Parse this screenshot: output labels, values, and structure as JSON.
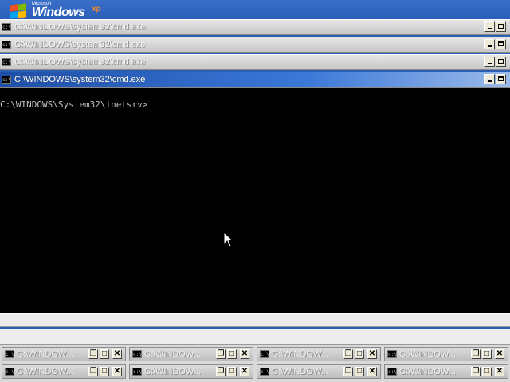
{
  "desktop": {
    "logo": {
      "microsoft": "Microsoft",
      "windows": "Windows",
      "xp": "xp"
    }
  },
  "title_bars": [
    {
      "title": "C:\\WINDOWS\\system32\\cmd.exe",
      "state": "inactive"
    },
    {
      "title": "C:\\WINDOWS\\system32\\cmd.exe",
      "state": "inactive"
    },
    {
      "title": "C:\\WINDOWS\\system32\\cmd.exe",
      "state": "inactive"
    },
    {
      "title": "C:\\WINDOWS\\system32\\cmd.exe",
      "state": "active"
    }
  ],
  "console": {
    "prompt": "C:\\WINDOWS\\System32\\inetsrv>",
    "background": "#000000",
    "text_color": "#c0c0c0"
  },
  "minimized_windows": {
    "row1": [
      {
        "label": "C:\\WINDOW..."
      },
      {
        "label": "C:\\WINDOW..."
      },
      {
        "label": "C:\\WINDOW..."
      },
      {
        "label": "C:\\WINDOW..."
      }
    ],
    "row2": [
      {
        "label": "C:\\WINDOW..."
      },
      {
        "label": "C:\\WINDOW..."
      },
      {
        "label": "C:\\WINDOW..."
      },
      {
        "label": "C:\\WINDOW..."
      }
    ]
  },
  "icons": {
    "window_icon": "cmd-icon",
    "minimize": "minimize-icon",
    "maximize": "maximize-icon",
    "restore": "restore-icon",
    "close": "close-icon",
    "pointer": "mouse-pointer-icon"
  },
  "colors": {
    "active_title": "#3b78d8",
    "inactive_title": "#c7c7c7",
    "desktop": "#2b5fb3"
  }
}
